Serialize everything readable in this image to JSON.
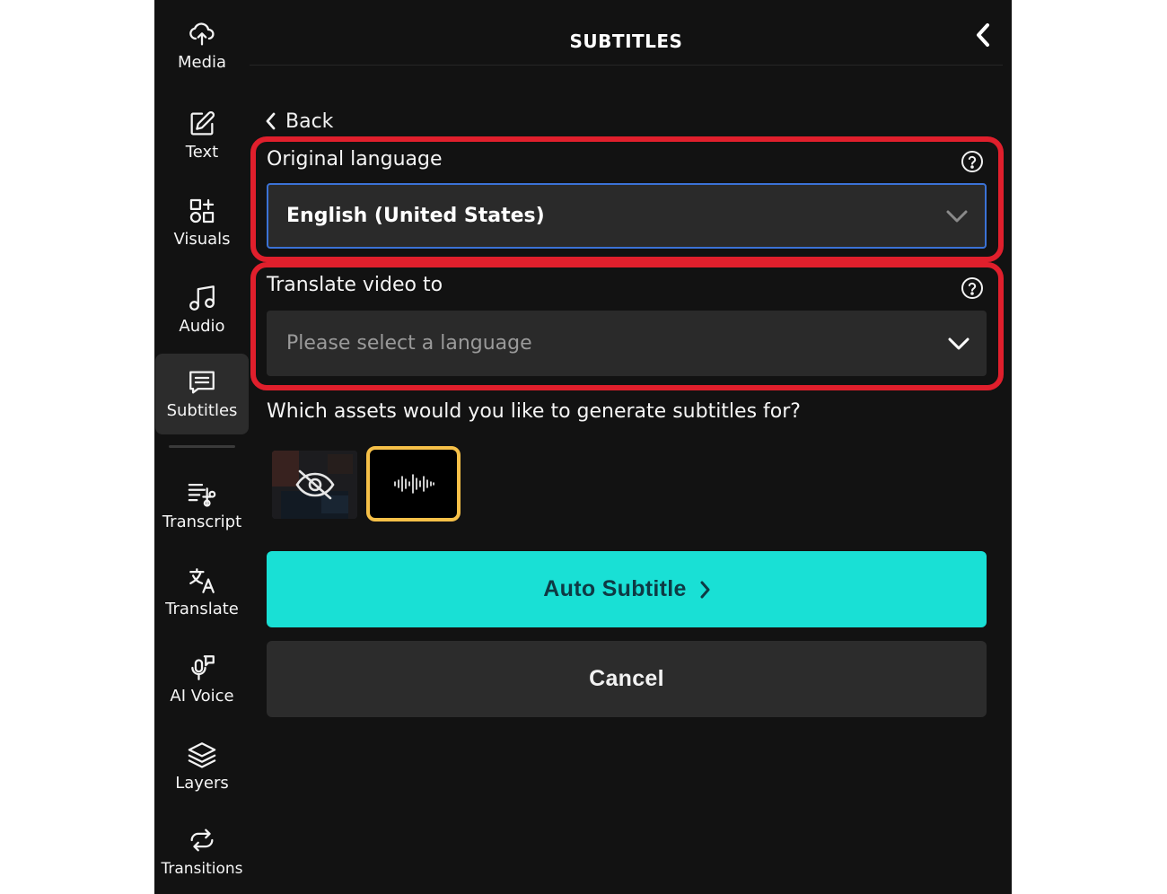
{
  "sidebar": {
    "items": [
      {
        "label": "Media",
        "icon": "upload-cloud-icon"
      },
      {
        "label": "Text",
        "icon": "edit-icon"
      },
      {
        "label": "Visuals",
        "icon": "shapes-icon"
      },
      {
        "label": "Audio",
        "icon": "music-note-icon"
      },
      {
        "label": "Subtitles",
        "icon": "subtitles-icon",
        "active": true
      },
      {
        "label": "Transcript",
        "icon": "transcript-icon"
      },
      {
        "label": "Translate",
        "icon": "translate-icon"
      },
      {
        "label": "AI Voice",
        "icon": "microphone-icon"
      },
      {
        "label": "Layers",
        "icon": "layers-icon"
      },
      {
        "label": "Transitions",
        "icon": "transitions-icon"
      }
    ]
  },
  "panel": {
    "title": "SUBTITLES",
    "back_label": "Back",
    "original_language": {
      "label": "Original language",
      "value": "English (United States)"
    },
    "translate_to": {
      "label": "Translate video to",
      "placeholder": "Please select a language"
    },
    "assets_question": "Which assets would you like to generate subtitles for?",
    "auto_subtitle_label": "Auto Subtitle",
    "cancel_label": "Cancel"
  },
  "colors": {
    "background": "#121212",
    "accent": "#19e0d5",
    "highlight": "#e01f2c",
    "selected_asset_border": "#f6c048",
    "focus_border": "#3b72d6"
  }
}
